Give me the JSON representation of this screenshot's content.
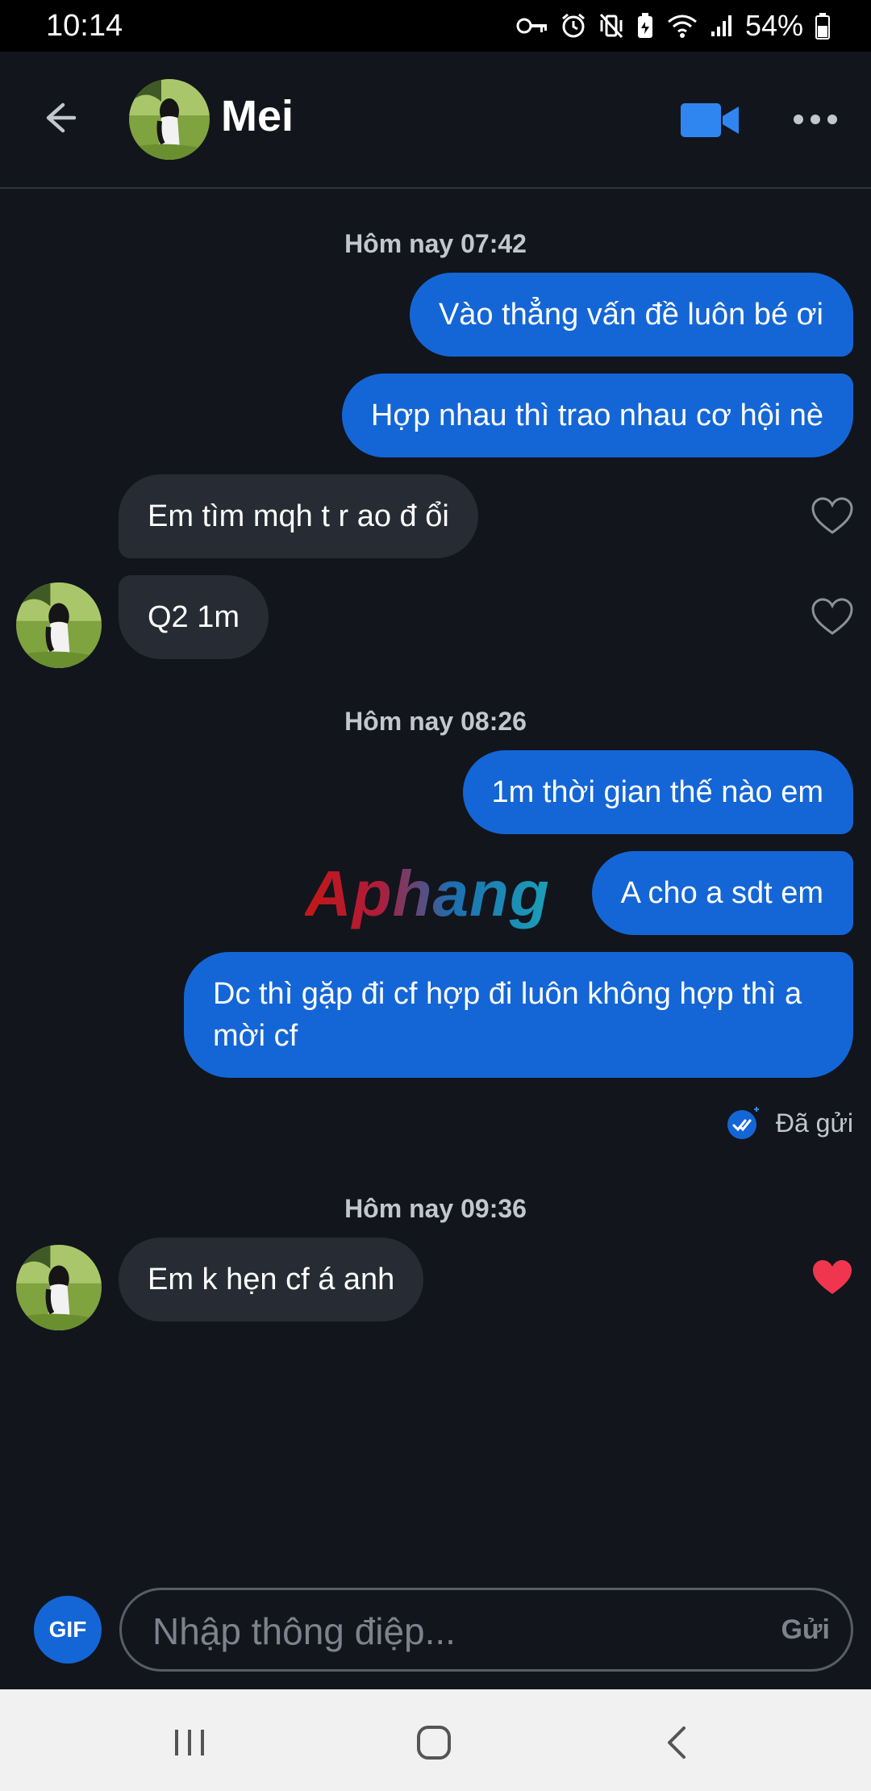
{
  "status_bar": {
    "time": "10:14",
    "battery": "54%"
  },
  "header": {
    "contact_name": "Mei",
    "icons": [
      "back-arrow-icon",
      "video-camera-icon",
      "more-dots-icon"
    ]
  },
  "conversation": {
    "timestamps": [
      "Hôm nay 07:42",
      "Hôm nay 08:26",
      "Hôm nay 09:36"
    ],
    "messages": [
      {
        "from": "me",
        "text": "Vào thẳng vấn đề luôn bé ơi"
      },
      {
        "from": "me",
        "text": "Hợp nhau thì trao nhau cơ hội nè"
      },
      {
        "from": "them",
        "text": "Em tìm mqh t r ao đ ổi",
        "liked": false
      },
      {
        "from": "them",
        "text": "Q2 1m",
        "liked": false
      },
      {
        "from": "me",
        "text": "1m thời gian thế nào em"
      },
      {
        "from": "me",
        "text": "A cho a sdt em"
      },
      {
        "from": "me",
        "text": "Dc thì gặp đi cf hợp đi luôn không hợp thì a mời cf"
      },
      {
        "from": "them",
        "text": "Em k hẹn cf á anh",
        "liked": true
      }
    ],
    "sent_status": "Đã gửi"
  },
  "watermark": "Aphang",
  "composer": {
    "gif_label": "GIF",
    "placeholder": "Nhập thông điệp...",
    "send_label": "Gửi"
  },
  "colors": {
    "background": "#12151c",
    "outgoing_bubble": "#1466d6",
    "incoming_bubble": "#272b34",
    "liked_heart": "#f0364f"
  }
}
